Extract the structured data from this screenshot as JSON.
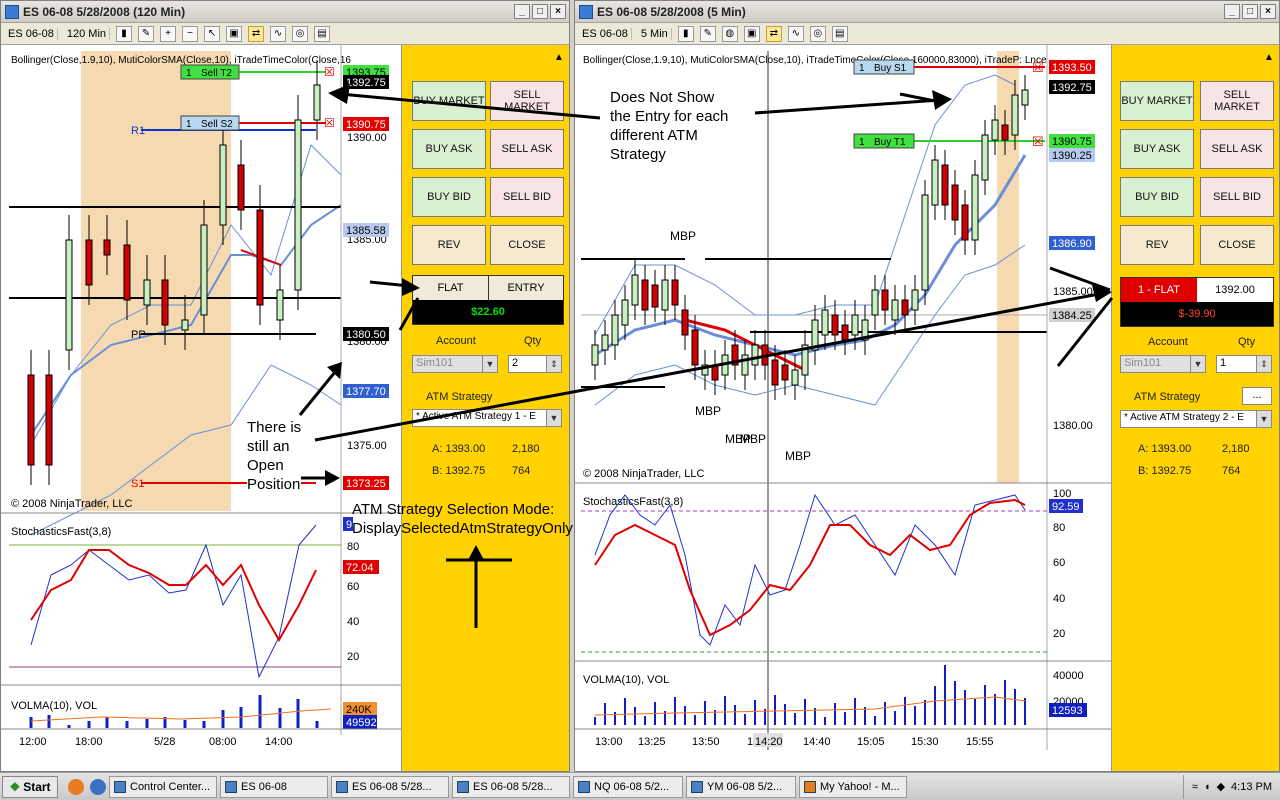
{
  "left_window": {
    "title": "ES 06-08  5/28/2008 (120 Min)",
    "instrument": "ES 06-08",
    "interval": "120 Min",
    "indicators_label": "Bollinger(Close,1.9,10), MutiColorSMA(Close,10), iTradeTimeColor(Close,16",
    "copyright": "© 2008 NinjaTrader, LLC",
    "price_ticks": [
      "1390.00",
      "1385.00",
      "1380.00",
      "1375.00"
    ],
    "price_flags": [
      "1393.75",
      "1392.75",
      "1390.75",
      "1385.58",
      "1380.50",
      "1377.70",
      "1373.25"
    ],
    "order_tags": [
      {
        "qty": "1",
        "name": "Sell T2"
      },
      {
        "qty": "1",
        "name": "Sell S2"
      }
    ],
    "pivot_labels": [
      "R1",
      "PP",
      "S1"
    ],
    "stoch_label": "StochasticsFast(3,8)",
    "stoch_ticks": [
      "80",
      "60",
      "40",
      "20"
    ],
    "stoch_flags": [
      "9",
      "72.04"
    ],
    "vol_label": "VOLMA(10), VOL",
    "vol_flags": [
      "240K",
      "49592"
    ],
    "time_ticks": [
      "12:00",
      "18:00",
      "5/28",
      "08:00",
      "14:00"
    ]
  },
  "right_window": {
    "title": "ES 06-08  5/28/2008 (5 Min)",
    "instrument": "ES 06-08",
    "interval": "5 Min",
    "indicators_label": "Bollinger(Close,1.9,10), MutiColorSMA(Close,10), iTradeTimeColor(Close,160000,83000), iTradeP: Lnce",
    "copyright": "© 2008 NinjaTrader, LLC",
    "price_ticks": [
      "1390.00",
      "1385.00",
      "1380.00"
    ],
    "price_flags": [
      "1393.50",
      "1392.75",
      "1390.75",
      "1390.25",
      "1386.90",
      "1384.25"
    ],
    "order_tags": [
      {
        "qty": "1",
        "name": "Buy S1"
      },
      {
        "qty": "1",
        "name": "Buy T1"
      }
    ],
    "mbp_labels": [
      "MBP",
      "MBP",
      "MBP",
      "MBP",
      "MBP"
    ],
    "stoch_label": "StochasticsFast(3,8)",
    "stoch_ticks": [
      "100",
      "80",
      "60",
      "40",
      "20"
    ],
    "stoch_flag": "92.59",
    "vol_label": "VOLMA(10), VOL",
    "vol_ticks": [
      "40000",
      "20000"
    ],
    "vol_flag": "12593",
    "time_ticks": [
      "13:00",
      "13:25",
      "13:50",
      "14:15",
      "14:20",
      "14:40",
      "15:05",
      "15:30",
      "15:55"
    ]
  },
  "left_atm": {
    "buttons": {
      "buy_market": "BUY MARKET",
      "sell_market": "SELL MARKET",
      "buy_ask": "BUY ASK",
      "sell_ask": "SELL ASK",
      "buy_bid": "BUY BID",
      "sell_bid": "SELL BID",
      "rev": "REV",
      "close": "CLOSE"
    },
    "position_label": "FLAT",
    "entry_label": "ENTRY",
    "pnl": "$22.60",
    "account_label": "Account",
    "qty_label": "Qty",
    "account": "Sim101",
    "qty": "2",
    "atm_label": "ATM Strategy",
    "atm_value": "* Active ATM Strategy 1 - E",
    "ask_label": "A: 1393.00",
    "ask_size": "2,180",
    "bid_label": "B: 1392.75",
    "bid_size": "764"
  },
  "right_atm": {
    "buttons": {
      "buy_market": "BUY MARKET",
      "sell_market": "SELL MARKET",
      "buy_ask": "BUY ASK",
      "sell_ask": "SELL ASK",
      "buy_bid": "BUY BID",
      "sell_bid": "SELL BID",
      "rev": "REV",
      "close": "CLOSE"
    },
    "position_label": "1 - FLAT",
    "entry_value": "1392.00",
    "pnl": "$-39.90",
    "account_label": "Account",
    "qty_label": "Qty",
    "account": "Sim101",
    "qty": "1",
    "atm_label": "ATM Strategy",
    "atm_value": "* Active ATM Strategy 2 - E",
    "ask_label": "A: 1393.00",
    "ask_size": "2,180",
    "bid_label": "B: 1392.75",
    "bid_size": "764"
  },
  "annotations": {
    "entry_note_lines": [
      "Does Not Show",
      "the Entry for each",
      "different ATM",
      "Strategy"
    ],
    "open_note_lines": [
      "There is",
      "still an",
      "Open",
      "Position"
    ],
    "mode_note_lines": [
      "ATM Strategy Selection Mode:",
      "DisplaySelectedAtmStrategyOnly"
    ]
  },
  "taskbar": {
    "start": "Start",
    "tasks": [
      "Control Center...",
      "ES 06-08",
      "ES 06-08  5/28...",
      "ES 06-08  5/28...",
      "NQ 06-08  5/2...",
      "YM 06-08  5/2...",
      "My Yahoo! - M..."
    ],
    "clock": "4:13 PM"
  },
  "colors": {
    "atm_bg": "#ffd200",
    "flat_red": "#e00000",
    "entry_black": "#000000",
    "pnl_green": "#00e000",
    "pnl_red": "#ff4040"
  }
}
